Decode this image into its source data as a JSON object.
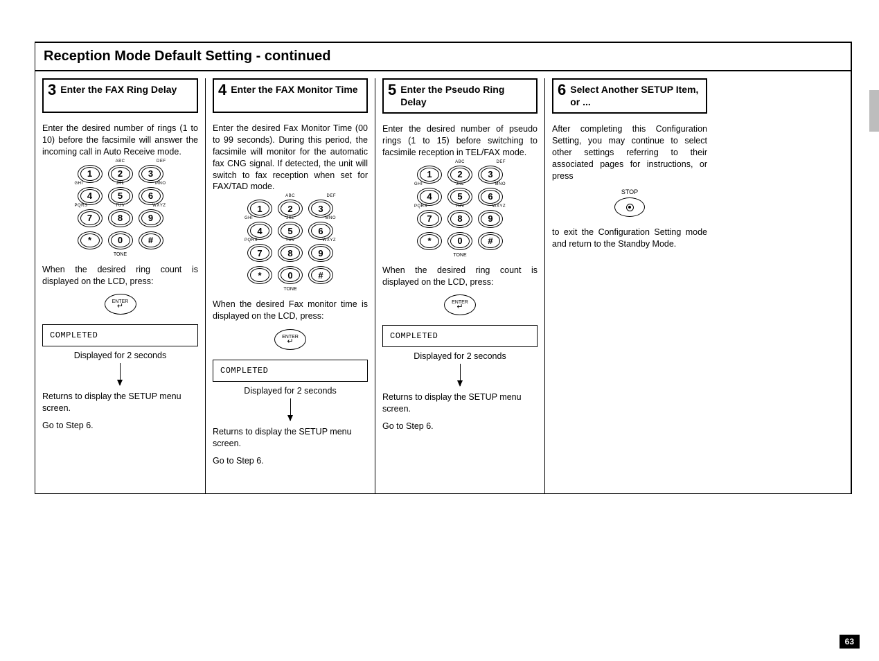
{
  "page": {
    "section_title": "Reception Mode Default Setting - continued",
    "page_number": "63"
  },
  "keypad": {
    "k1": "1",
    "k2": "2",
    "k3": "3",
    "k4": "4",
    "k5": "5",
    "k6": "6",
    "k7": "7",
    "k8": "8",
    "k9": "9",
    "ks": "*",
    "k0": "0",
    "kh": "#",
    "abc": "ABC",
    "def": "DEF",
    "ghi": "GHI",
    "jkl": "JKL",
    "mno": "MNO",
    "pqrs": "PQRS",
    "tuv": "TUV",
    "wxyz": "WXYZ",
    "tone": "TONE"
  },
  "buttons": {
    "enter": "ENTER",
    "stop": "STOP"
  },
  "lcd": {
    "completed": "COMPLETED"
  },
  "common": {
    "displayed_2s": "Displayed for 2 seconds",
    "returns": "Returns to display the SETUP menu screen.",
    "goto6": "Go to Step 6."
  },
  "steps": {
    "s3": {
      "num": "3",
      "title": "Enter the FAX Ring Delay",
      "body1": "Enter the desired number of rings (1 to 10) before the facsimile will answer the incoming call in Auto Receive mode.",
      "body2": "When the desired ring count is displayed on the LCD, press:"
    },
    "s4": {
      "num": "4",
      "title": "Enter the FAX Monitor Time",
      "body1": "Enter the desired Fax Monitor Time (00 to 99 seconds). During this period, the facsimile will monitor for the automatic fax CNG signal. If detected, the unit will switch to fax reception when set for FAX/TAD mode.",
      "body2": "When the desired Fax monitor time is displayed on the LCD, press:"
    },
    "s5": {
      "num": "5",
      "title": "Enter the Pseudo Ring Delay",
      "body1": "Enter the desired number of pseudo rings (1 to 15) before switching to facsimile reception in TEL/FAX mode.",
      "body2": "When the desired ring count is displayed on the LCD, press:"
    },
    "s6": {
      "num": "6",
      "title": "Select Another SETUP Item, or ...",
      "body1": "After completing this Configuration Setting, you may continue to select other settings referring to their associated pages for instructions, or press",
      "body2": "to exit the Configuration Setting mode and return to the Standby Mode."
    }
  }
}
